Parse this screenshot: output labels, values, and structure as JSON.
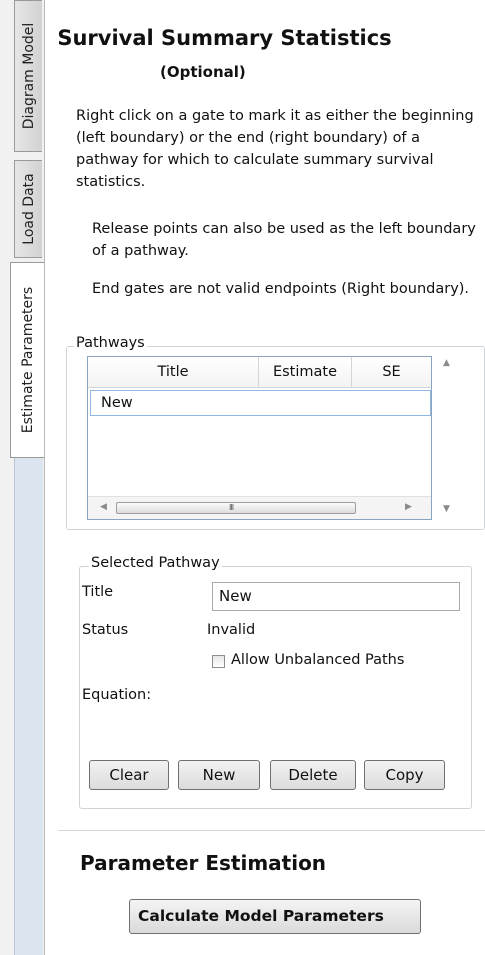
{
  "tabs": [
    {
      "label": "Diagram Model",
      "active": false
    },
    {
      "label": "Load Data",
      "active": false
    },
    {
      "label": "Estimate Parameters",
      "active": true
    }
  ],
  "header": {
    "title": "Survival Summary Statistics",
    "subtitle": "(Optional)"
  },
  "instructions": {
    "main": "Right click on a gate to mark it as either the beginning (left boundary) or the end (right boundary) of a pathway for which to calculate summary survival statistics.",
    "note1": "Release points can also be used as the left boundary of a pathway.",
    "note2": "End gates are not valid endpoints (Right boundary)."
  },
  "pathways": {
    "legend": "Pathways",
    "columns": [
      "Title",
      "Estimate",
      "SE"
    ],
    "rows": [
      {
        "title": "New",
        "estimate": "",
        "se": ""
      }
    ],
    "scroll_grip": "III"
  },
  "selected_pathway": {
    "legend": "Selected Pathway",
    "title_label": "Title",
    "title_value": "New",
    "status_label": "Status",
    "status_value": "Invalid",
    "allow_unbalanced_label": "Allow Unbalanced Paths",
    "allow_unbalanced_checked": false,
    "equation_label": "Equation:",
    "buttons": {
      "clear": "Clear",
      "new": "New",
      "delete": "Delete",
      "copy": "Copy"
    }
  },
  "parameter_estimation": {
    "title": "Parameter Estimation",
    "calculate_button": "Calculate Model Parameters"
  },
  "colors": {
    "tab_background": "#dbe5ef",
    "grid_border": "#8aa4c2",
    "row_selection_border": "#8fb7e3"
  }
}
